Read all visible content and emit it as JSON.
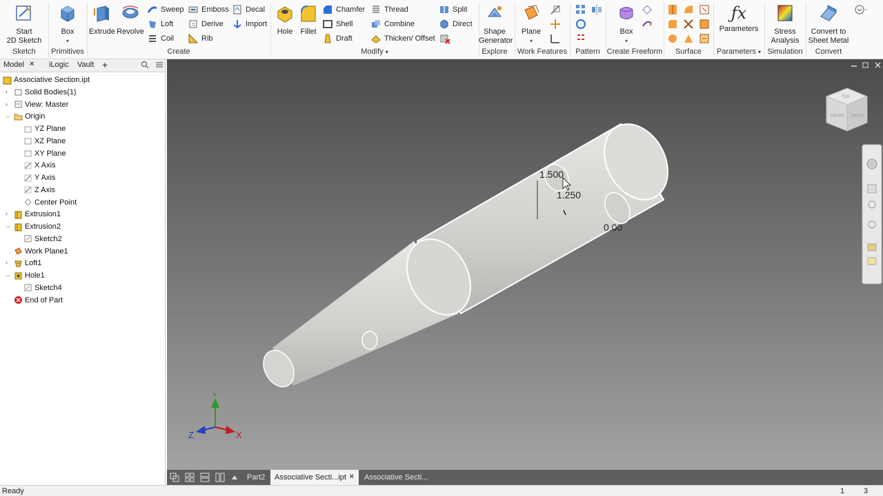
{
  "ribbon": {
    "sketch": {
      "start_label": "Start\n2D Sketch",
      "panel": "Sketch"
    },
    "primitives": {
      "box_label": "Box",
      "panel": "Primitives"
    },
    "create": {
      "extrude": "Extrude",
      "revolve": "Revolve",
      "sweep": "Sweep",
      "loft": "Loft",
      "coil": "Coil",
      "emboss": "Emboss",
      "derive": "Derive",
      "rib": "Rib",
      "decal": "Decal",
      "import": "Import",
      "panel": "Create"
    },
    "modify": {
      "hole": "Hole",
      "fillet": "Fillet",
      "chamfer": "Chamfer",
      "shell": "Shell",
      "draft": "Draft",
      "thread": "Thread",
      "combine": "Combine",
      "thicken": "Thicken/ Offset",
      "split": "Split",
      "direct": "Direct",
      "panel": "Modify"
    },
    "explore": {
      "shape_generator": "Shape\nGenerator",
      "panel": "Explore"
    },
    "work_features": {
      "plane": "Plane",
      "panel": "Work Features"
    },
    "pattern": {
      "panel": "Pattern"
    },
    "freeform": {
      "box": "Box",
      "panel": "Create Freeform"
    },
    "surface": {
      "panel": "Surface"
    },
    "parameters": {
      "label": "Parameters",
      "panel": "Parameters"
    },
    "simulation": {
      "label": "Stress\nAnalysis",
      "panel": "Simulation"
    },
    "convert": {
      "label": "Convert to\nSheet Metal",
      "panel": "Convert"
    }
  },
  "browser": {
    "tabs": [
      "Model",
      "iLogic",
      "Vault"
    ],
    "tree": [
      {
        "label": "Associative Section.ipt",
        "icon": "part-icon"
      },
      {
        "label": "Solid Bodies(1)",
        "icon": "solid-bodies-icon"
      },
      {
        "label": "View: Master",
        "icon": "view-icon"
      },
      {
        "label": "Origin",
        "icon": "folder-icon"
      },
      {
        "label": "YZ Plane",
        "icon": "plane-icon"
      },
      {
        "label": "XZ Plane",
        "icon": "plane-icon"
      },
      {
        "label": "XY Plane",
        "icon": "plane-icon"
      },
      {
        "label": "X Axis",
        "icon": "axis-icon"
      },
      {
        "label": "Y Axis",
        "icon": "axis-icon"
      },
      {
        "label": "Z Axis",
        "icon": "axis-icon"
      },
      {
        "label": "Center Point",
        "icon": "point-icon"
      },
      {
        "label": "Extrusion1",
        "icon": "extrusion-icon"
      },
      {
        "label": "Extrusion2",
        "icon": "extrusion-icon"
      },
      {
        "label": "Sketch2",
        "icon": "sketch-icon"
      },
      {
        "label": "Work Plane1",
        "icon": "work-plane-icon"
      },
      {
        "label": "Loft1",
        "icon": "loft-icon"
      },
      {
        "label": "Hole1",
        "icon": "hole-icon"
      },
      {
        "label": "Sketch4",
        "icon": "sketch-icon"
      },
      {
        "label": "End of Part",
        "icon": "end-of-part-icon"
      }
    ]
  },
  "viewport": {
    "dim1": "1.500",
    "dim2": "1.250",
    "dim3": "0.00",
    "axis_x": "X",
    "axis_y": "Y",
    "axis_z": "Z",
    "viewcube_front": "FRONT",
    "viewcube_right": "RIGHT",
    "viewcube_top": "TOP"
  },
  "doc_tabs": [
    {
      "label": "Part2",
      "active": false
    },
    {
      "label": "Associative Secti...ipt",
      "active": true
    },
    {
      "label": "Associative Secti...",
      "active": false
    }
  ],
  "status": {
    "text": "Ready",
    "count1": "1",
    "count2": "3"
  },
  "colors": {
    "accent_blue": "#2a6fd6",
    "ribbon_orange": "#f0a030",
    "viewport_top": "#4b4b4b",
    "part_body": "#d8d8d4"
  }
}
